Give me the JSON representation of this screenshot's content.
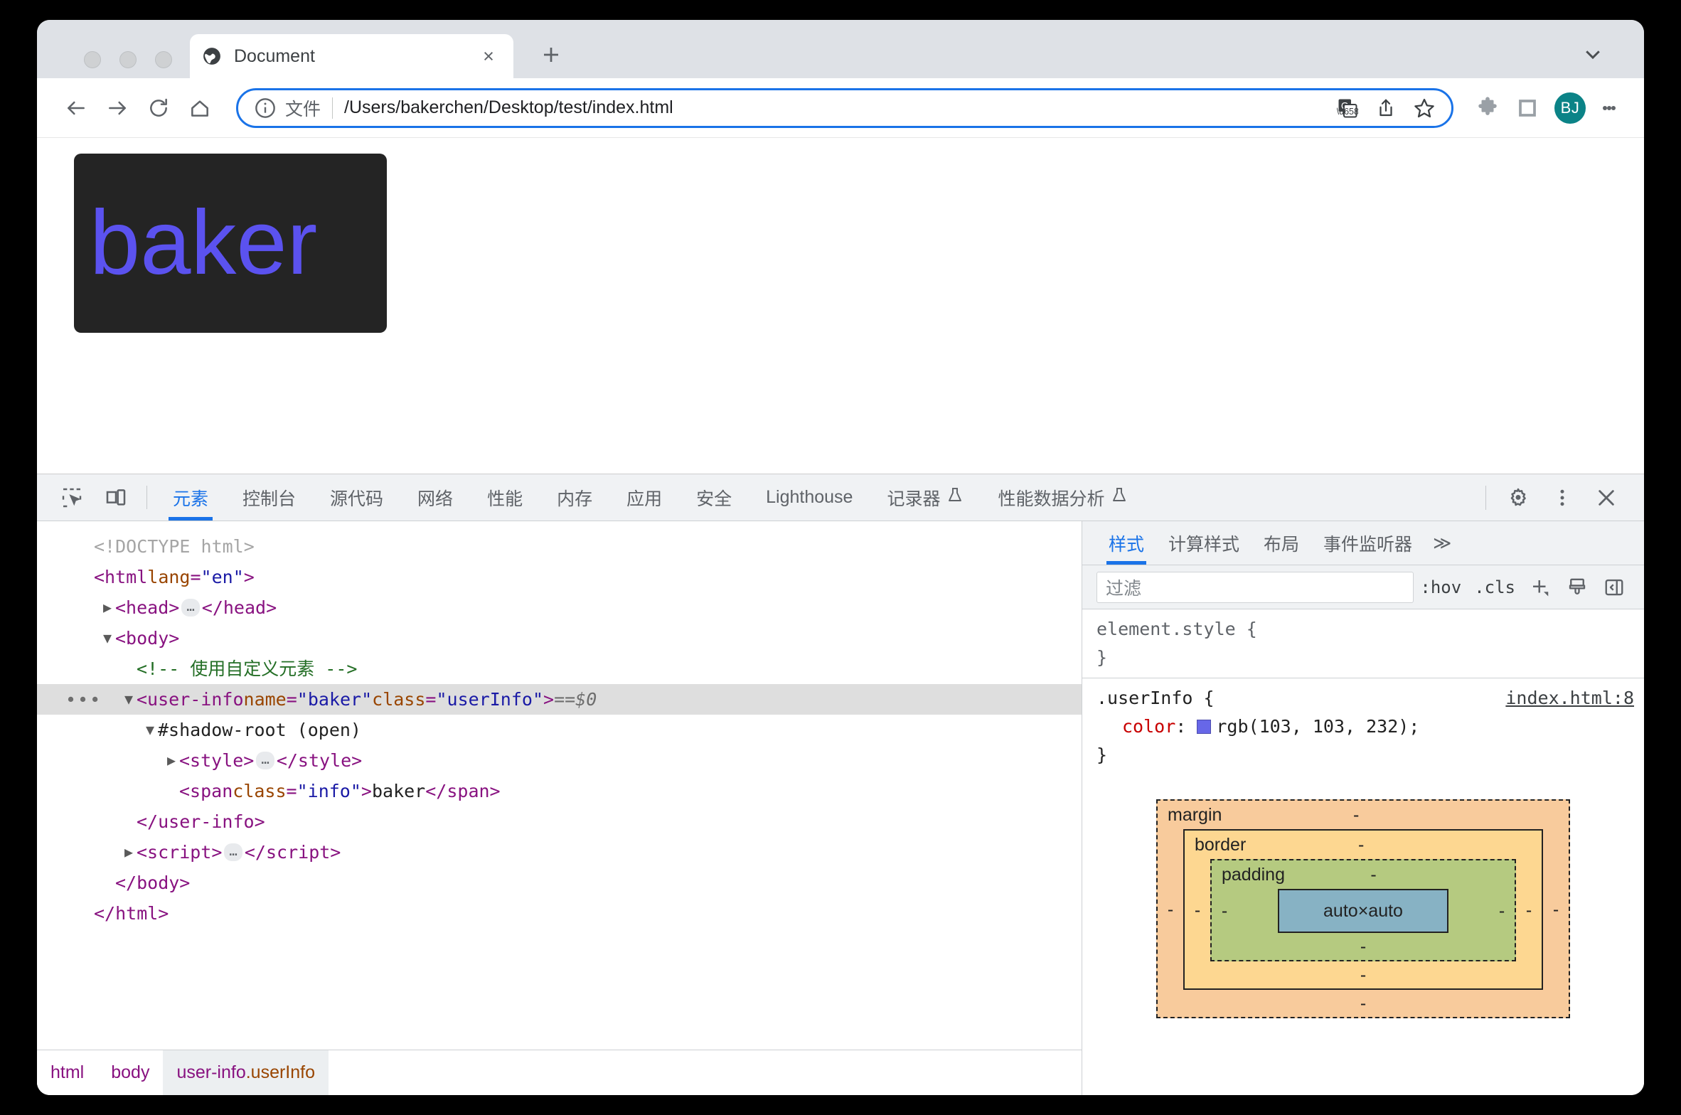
{
  "browser": {
    "tab": {
      "title": "Document",
      "favicon": "globe-icon",
      "close": "×"
    },
    "new_tab_label": "+",
    "omnibox": {
      "scheme_label": "文件",
      "url": "/Users/bakerchen/Desktop/test/index.html",
      "separator": "|",
      "info_icon": "info-circle-icon",
      "translate_icon": "translate-icon",
      "share_icon": "share-icon",
      "bookmark_icon": "star-icon"
    },
    "extensions_icon": "puzzle-icon",
    "sidepanel_icon": "side-panel-icon",
    "avatar_initials": "BJ",
    "menu_icon": "kebab-menu-icon",
    "accent_color": "#1a73e8",
    "avatar_color": "#0b8387"
  },
  "page": {
    "logo_text": "baker",
    "logo_bg": "#242424",
    "logo_color": "#5b52ef"
  },
  "devtools": {
    "inspect_icon": "inspect-element-icon",
    "device_icon": "device-toolbar-icon",
    "tabs": [
      {
        "label": "元素",
        "active": true,
        "flask": ""
      },
      {
        "label": "控制台",
        "active": false,
        "flask": ""
      },
      {
        "label": "源代码",
        "active": false,
        "flask": ""
      },
      {
        "label": "网络",
        "active": false,
        "flask": ""
      },
      {
        "label": "性能",
        "active": false,
        "flask": ""
      },
      {
        "label": "内存",
        "active": false,
        "flask": ""
      },
      {
        "label": "应用",
        "active": false,
        "flask": ""
      },
      {
        "label": "安全",
        "active": false,
        "flask": ""
      },
      {
        "label": "Lighthouse",
        "active": false,
        "flask": ""
      },
      {
        "label": "记录器",
        "active": false,
        "flask": "⨁"
      },
      {
        "label": "性能数据分析",
        "active": false,
        "flask": "⨁"
      }
    ],
    "settings_icon": "gear-icon",
    "more_icon": "kebab-menu-icon",
    "close_icon": "close-icon",
    "dom_tree": [
      {
        "indent": 0,
        "arrow": "",
        "parts": [
          {
            "c": "doctype",
            "t": "<!DOCTYPE html>"
          }
        ]
      },
      {
        "indent": 0,
        "arrow": "",
        "parts": [
          {
            "c": "tg",
            "t": "<html "
          },
          {
            "c": "at",
            "t": "lang"
          },
          {
            "c": "tg",
            "t": "="
          },
          {
            "c": "av",
            "t": "\"en\""
          },
          {
            "c": "tg",
            "t": ">"
          }
        ]
      },
      {
        "indent": 1,
        "arrow": "▶",
        "parts": [
          {
            "c": "tg",
            "t": "<head>"
          },
          {
            "c": "ellip",
            "t": "…"
          },
          {
            "c": "tg",
            "t": "</head>"
          }
        ]
      },
      {
        "indent": 1,
        "arrow": "▼",
        "parts": [
          {
            "c": "tg",
            "t": "<body>"
          }
        ]
      },
      {
        "indent": 2,
        "arrow": "",
        "parts": [
          {
            "c": "cm",
            "t": "<!-- 使用自定义元素 -->"
          }
        ]
      },
      {
        "indent": 2,
        "arrow": "▼",
        "selected": true,
        "dots": "…",
        "parts": [
          {
            "c": "tg",
            "t": "<user-info "
          },
          {
            "c": "at",
            "t": "name"
          },
          {
            "c": "tg",
            "t": "="
          },
          {
            "c": "av",
            "t": "\"baker\""
          },
          {
            "c": "tg",
            "t": " "
          },
          {
            "c": "at",
            "t": "class"
          },
          {
            "c": "tg",
            "t": "="
          },
          {
            "c": "av",
            "t": "\"userInfo\""
          },
          {
            "c": "tg",
            "t": ">"
          },
          {
            "c": "meta",
            "t": " == "
          },
          {
            "c": "dollar",
            "t": "$0"
          }
        ]
      },
      {
        "indent": 3,
        "arrow": "▼",
        "parts": [
          {
            "c": "shadow",
            "t": "#shadow-root (open)"
          }
        ]
      },
      {
        "indent": 4,
        "arrow": "▶",
        "parts": [
          {
            "c": "tg",
            "t": "<style>"
          },
          {
            "c": "ellip",
            "t": "…"
          },
          {
            "c": "tg",
            "t": "</style>"
          }
        ]
      },
      {
        "indent": 4,
        "arrow": "",
        "parts": [
          {
            "c": "tg",
            "t": "<span "
          },
          {
            "c": "at",
            "t": "class"
          },
          {
            "c": "tg",
            "t": "="
          },
          {
            "c": "av",
            "t": "\"info\""
          },
          {
            "c": "tg",
            "t": ">"
          },
          {
            "c": "txt",
            "t": "baker"
          },
          {
            "c": "tg",
            "t": "</span>"
          }
        ]
      },
      {
        "indent": 2,
        "arrow": "",
        "parts": [
          {
            "c": "tg",
            "t": "</user-info>"
          }
        ]
      },
      {
        "indent": 2,
        "arrow": "▶",
        "parts": [
          {
            "c": "tg",
            "t": "<script>"
          },
          {
            "c": "ellip",
            "t": "…"
          },
          {
            "c": "tg",
            "t": "</scr"
          },
          {
            "c": "tg",
            "t": "ipt>"
          }
        ]
      },
      {
        "indent": 1,
        "arrow": "",
        "parts": [
          {
            "c": "tg",
            "t": "</body>"
          }
        ]
      },
      {
        "indent": 0,
        "arrow": "",
        "parts": [
          {
            "c": "tg",
            "t": "</html>"
          }
        ]
      }
    ],
    "breadcrumb": [
      {
        "tag": "html",
        "cls": "",
        "active": false
      },
      {
        "tag": "body",
        "cls": "",
        "active": false
      },
      {
        "tag": "user-info",
        "cls": ".userInfo",
        "active": true
      }
    ],
    "styles": {
      "tabs": [
        {
          "label": "样式",
          "active": true
        },
        {
          "label": "计算样式",
          "active": false
        },
        {
          "label": "布局",
          "active": false
        },
        {
          "label": "事件监听器",
          "active": false
        }
      ],
      "more_label": "≫",
      "filter_placeholder": "过滤",
      "filter_value": "",
      "hov_label": ":hov",
      "cls_label": ".cls",
      "new_rule_icon": "plus-icon",
      "copy_icon": "paintbrush-icon",
      "sidebar_icon": "toggle-sidebar-icon",
      "rules": [
        {
          "selector": "element.style {",
          "selector_grey": true,
          "origin": "",
          "declarations": [],
          "close": "}"
        },
        {
          "selector": ".userInfo {",
          "selector_grey": false,
          "origin": "index.html:8",
          "declarations": [
            {
              "prop": "color",
              "value": "rgb(103, 103, 232)",
              "swatch": "#6767e8"
            }
          ],
          "close": "}"
        }
      ]
    },
    "box_model": {
      "margin_label": "margin",
      "border_label": "border",
      "padding_label": "padding",
      "content_label": "auto×auto",
      "dash": "-",
      "colors": {
        "margin": "#f8cb9c",
        "border": "#fdd791",
        "padding": "#b5ca80",
        "content": "#87b2c4"
      }
    }
  }
}
